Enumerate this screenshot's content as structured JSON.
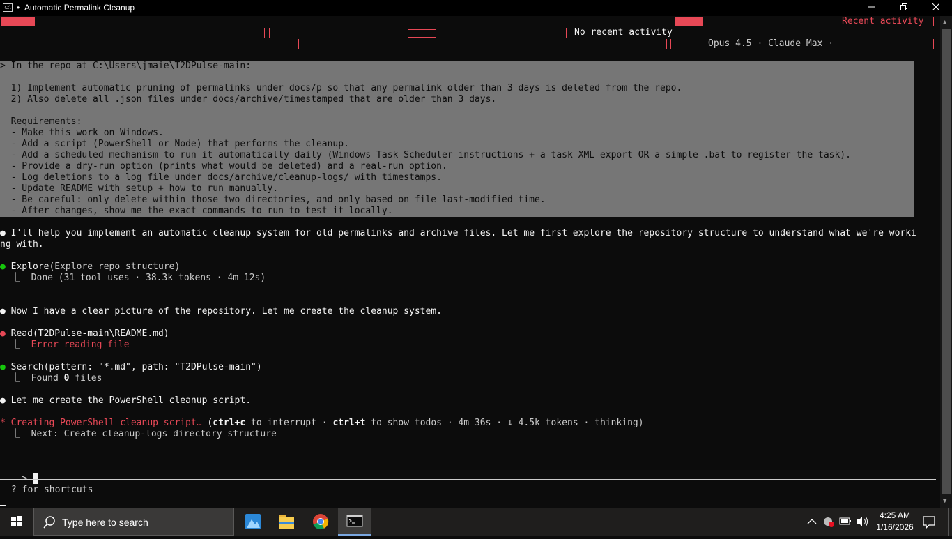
{
  "window": {
    "title": "Automatic Permalink Cleanup",
    "title_dot": "•",
    "app_icon": "C:\\",
    "controls": [
      "minimize-icon",
      "restore-icon",
      "close-icon"
    ]
  },
  "header": {
    "recent_activity": "Recent activity",
    "no_recent_activity": "No recent activity",
    "model_info": "Opus 4.5 · Claude Max ·"
  },
  "prompt": {
    "lines": [
      "> In the repo at C:\\Users\\jmaie\\T2DPulse-main:",
      "",
      "  1) Implement automatic pruning of permalinks under docs/p so that any permalink older than 3 days is deleted from the repo.",
      "  2) Also delete all .json files under docs/archive/timestamped that are older than 3 days.",
      "",
      "  Requirements:",
      "  - Make this work on Windows.",
      "  - Add a script (PowerShell or Node) that performs the cleanup.",
      "  - Add a scheduled mechanism to run it automatically daily (Windows Task Scheduler instructions + a task XML export OR a simple .bat to register the task).",
      "  - Provide a dry-run option (prints what would be deleted) and a real-run option.",
      "  - Log deletions to a log file under docs/archive/cleanup-logs/ with timestamps.",
      "  - Update README with setup + how to run manually.",
      "  - Be careful: only delete within those two directories, and only based on file last-modified time.",
      "  - After changes, show me the exact commands to run to test it locally."
    ]
  },
  "conversation": {
    "msg1_line1": " I'll help you implement an automatic cleanup system for old permalinks and archive files. Let me first explore the repository structure to understand what we're worki",
    "msg1_line2": "ng with.",
    "explore_tool": "Explore",
    "explore_args": "(Explore repo structure)",
    "explore_result": "  Done (31 tool uses · 38.3k tokens · 4m 12s)",
    "msg2": " Now I have a clear picture of the repository. Let me create the cleanup system.",
    "read_tool": "Read",
    "read_args": "(T2DPulse-main\\README.md)",
    "read_result": "Error reading file",
    "search_tool": "Search",
    "search_args": "(pattern: \"*.md\", path: \"T2DPulse-main\")",
    "search_result_prefix": "  Found ",
    "search_result_count": "0",
    "search_result_suffix": " files",
    "msg3": " Let me create the PowerShell cleanup script.",
    "status_spinner": "*",
    "status_action": " Creating PowerShell cleanup script…",
    "status_hint_open": " (",
    "status_key1": "ctrl+c",
    "status_mid1": " to interrupt · ",
    "status_key2": "ctrl+t",
    "status_mid2": " to show todos · 4m 36s · ↓ 4.5k tokens · thinking)",
    "next_label": "  Next: Create cleanup-logs directory structure",
    "result_glyph": "⎿",
    "bullet": "●"
  },
  "input": {
    "prompt_char": ">",
    "value": ""
  },
  "footer": {
    "shortcuts_hint": "? for shortcuts"
  },
  "taskbar": {
    "search_placeholder": "Type here to search",
    "pinned": [
      "photos-icon",
      "file-explorer-icon",
      "chrome-icon",
      "terminal-icon"
    ],
    "time": "4:25 AM",
    "date": "1/16/2026"
  },
  "colors": {
    "terminal_bg": "#0c0c0c",
    "prompt_bg": "#767676",
    "accent_red": "#e74856",
    "success_green": "#16c60c",
    "taskbar_bg": "#1f1e1d"
  }
}
